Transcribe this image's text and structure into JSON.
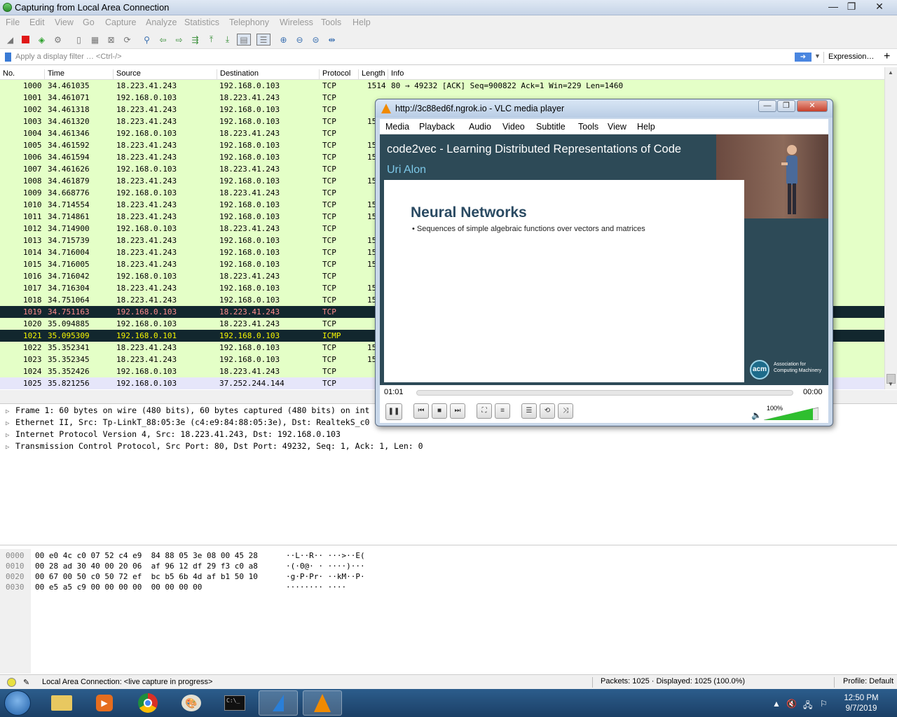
{
  "window": {
    "title": "Capturing from Local Area Connection",
    "controls": [
      "—",
      "❐",
      "✕"
    ]
  },
  "menu": [
    "File",
    "Edit",
    "View",
    "Go",
    "Capture",
    "Analyze",
    "Statistics",
    "Telephony",
    "Wireless",
    "Tools",
    "Help"
  ],
  "filter": {
    "placeholder": "Apply a display filter … <Ctrl-/>",
    "expression_label": "Expression…",
    "add_label": "+"
  },
  "columns": [
    "No.",
    "Time",
    "Source",
    "Destination",
    "Protocol",
    "Length",
    "Info"
  ],
  "packets": [
    {
      "no": "1000",
      "time": "34.461035",
      "src": "18.223.41.243",
      "dst": "192.168.0.103",
      "proto": "TCP",
      "len": "1514",
      "info": "80 → 49232 [ACK] Seq=900822 Ack=1 Win=229 Len=1460",
      "style": "green"
    },
    {
      "no": "1001",
      "time": "34.461071",
      "src": "192.168.0.103",
      "dst": "18.223.41.243",
      "proto": "TCP",
      "len": "",
      "info": "",
      "style": "green"
    },
    {
      "no": "1002",
      "time": "34.461318",
      "src": "18.223.41.243",
      "dst": "192.168.0.103",
      "proto": "TCP",
      "len": "",
      "info": "",
      "style": "green"
    },
    {
      "no": "1003",
      "time": "34.461320",
      "src": "18.223.41.243",
      "dst": "192.168.0.103",
      "proto": "TCP",
      "len": "15",
      "info": "",
      "style": "green"
    },
    {
      "no": "1004",
      "time": "34.461346",
      "src": "192.168.0.103",
      "dst": "18.223.41.243",
      "proto": "TCP",
      "len": "",
      "info": "",
      "style": "green"
    },
    {
      "no": "1005",
      "time": "34.461592",
      "src": "18.223.41.243",
      "dst": "192.168.0.103",
      "proto": "TCP",
      "len": "15",
      "info": "",
      "style": "green"
    },
    {
      "no": "1006",
      "time": "34.461594",
      "src": "18.223.41.243",
      "dst": "192.168.0.103",
      "proto": "TCP",
      "len": "15",
      "info": "",
      "style": "green"
    },
    {
      "no": "1007",
      "time": "34.461626",
      "src": "192.168.0.103",
      "dst": "18.223.41.243",
      "proto": "TCP",
      "len": "",
      "info": "",
      "style": "green"
    },
    {
      "no": "1008",
      "time": "34.461879",
      "src": "18.223.41.243",
      "dst": "192.168.0.103",
      "proto": "TCP",
      "len": "15",
      "info": "",
      "style": "green"
    },
    {
      "no": "1009",
      "time": "34.668776",
      "src": "192.168.0.103",
      "dst": "18.223.41.243",
      "proto": "TCP",
      "len": "",
      "info": "",
      "style": "green"
    },
    {
      "no": "1010",
      "time": "34.714554",
      "src": "18.223.41.243",
      "dst": "192.168.0.103",
      "proto": "TCP",
      "len": "15",
      "info": "",
      "style": "green"
    },
    {
      "no": "1011",
      "time": "34.714861",
      "src": "18.223.41.243",
      "dst": "192.168.0.103",
      "proto": "TCP",
      "len": "15",
      "info": "",
      "style": "green"
    },
    {
      "no": "1012",
      "time": "34.714900",
      "src": "192.168.0.103",
      "dst": "18.223.41.243",
      "proto": "TCP",
      "len": "",
      "info": "",
      "style": "green"
    },
    {
      "no": "1013",
      "time": "34.715739",
      "src": "18.223.41.243",
      "dst": "192.168.0.103",
      "proto": "TCP",
      "len": "15",
      "info": "",
      "style": "green"
    },
    {
      "no": "1014",
      "time": "34.716004",
      "src": "18.223.41.243",
      "dst": "192.168.0.103",
      "proto": "TCP",
      "len": "15",
      "info": "",
      "style": "green"
    },
    {
      "no": "1015",
      "time": "34.716005",
      "src": "18.223.41.243",
      "dst": "192.168.0.103",
      "proto": "TCP",
      "len": "15",
      "info": "",
      "style": "green"
    },
    {
      "no": "1016",
      "time": "34.716042",
      "src": "192.168.0.103",
      "dst": "18.223.41.243",
      "proto": "TCP",
      "len": "",
      "info": "",
      "style": "green"
    },
    {
      "no": "1017",
      "time": "34.716304",
      "src": "18.223.41.243",
      "dst": "192.168.0.103",
      "proto": "TCP",
      "len": "15",
      "info": "",
      "style": "green"
    },
    {
      "no": "1018",
      "time": "34.751064",
      "src": "18.223.41.243",
      "dst": "192.168.0.103",
      "proto": "TCP",
      "len": "15",
      "info": "",
      "style": "green"
    },
    {
      "no": "1019",
      "time": "34.751163",
      "src": "192.168.0.103",
      "dst": "18.223.41.243",
      "proto": "TCP",
      "len": "",
      "info": "",
      "style": "black"
    },
    {
      "no": "1020",
      "time": "35.094885",
      "src": "192.168.0.103",
      "dst": "18.223.41.243",
      "proto": "TCP",
      "len": "",
      "info": "",
      "style": "green"
    },
    {
      "no": "1021",
      "time": "35.095309",
      "src": "192.168.0.101",
      "dst": "192.168.0.103",
      "proto": "ICMP",
      "len": "",
      "info": "",
      "style": "black2"
    },
    {
      "no": "1022",
      "time": "35.352341",
      "src": "18.223.41.243",
      "dst": "192.168.0.103",
      "proto": "TCP",
      "len": "15",
      "info": "",
      "style": "green"
    },
    {
      "no": "1023",
      "time": "35.352345",
      "src": "18.223.41.243",
      "dst": "192.168.0.103",
      "proto": "TCP",
      "len": "15",
      "info": "",
      "style": "green"
    },
    {
      "no": "1024",
      "time": "35.352426",
      "src": "192.168.0.103",
      "dst": "18.223.41.243",
      "proto": "TCP",
      "len": "",
      "info": "",
      "style": "green"
    },
    {
      "no": "1025",
      "time": "35.821256",
      "src": "192.168.0.103",
      "dst": "37.252.244.144",
      "proto": "TCP",
      "len": "",
      "info": "",
      "style": "sel"
    }
  ],
  "details": [
    "Frame 1: 60 bytes on wire (480 bits), 60 bytes captured (480 bits) on int",
    "Ethernet II, Src: Tp-LinkT_88:05:3e (c4:e9:84:88:05:3e), Dst: RealtekS_c0",
    "Internet Protocol Version 4, Src: 18.223.41.243, Dst: 192.168.0.103",
    "Transmission Control Protocol, Src Port: 80, Dst Port: 49232, Seq: 1, Ack: 1, Len: 0"
  ],
  "bytes": [
    {
      "off": "0000",
      "hex": "00 e0 4c c0 07 52 c4 e9  84 88 05 3e 08 00 45 28",
      "ascii": "··L··R·· ···>··E("
    },
    {
      "off": "0010",
      "hex": "00 28 ad 30 40 00 20 06  af 96 12 df 29 f3 c0 a8",
      "ascii": "·(·0@· · ····)···"
    },
    {
      "off": "0020",
      "hex": "00 67 00 50 c0 50 72 ef  bc b5 6b 4d af b1 50 10",
      "ascii": "·g·P·Pr· ··kM··P·"
    },
    {
      "off": "0030",
      "hex": "00 e5 a5 c9 00 00 00 00  00 00 00 00",
      "ascii": "········ ····"
    }
  ],
  "status": {
    "interface": "Local Area Connection: <live capture in progress>",
    "packets": "Packets: 1025 · Displayed: 1025 (100.0%)",
    "profile": "Profile: Default"
  },
  "vlc": {
    "title": "http://3c88ed6f.ngrok.io - VLC media player",
    "menu": [
      "Media",
      "Playback",
      "Audio",
      "Video",
      "Subtitle",
      "Tools",
      "View",
      "Help"
    ],
    "video_title": "code2vec - Learning Distributed Representations of Code",
    "video_author": "Uri Alon",
    "slide_title": "Neural Networks",
    "slide_bullet": "•  Sequences of simple algebraic functions over vectors and matrices",
    "acm_text": "Association for Computing Machinery",
    "acm_logo": "acm",
    "elapsed": "01:01",
    "remaining": "00:00",
    "volume": "100%",
    "seek_progress": 0
  },
  "clock": {
    "time": "12:50 PM",
    "date": "9/7/2019"
  },
  "colors": {
    "green_row": "#e4ffc7",
    "black_row": "#12272e",
    "selected_row": "#e6e6fa"
  }
}
